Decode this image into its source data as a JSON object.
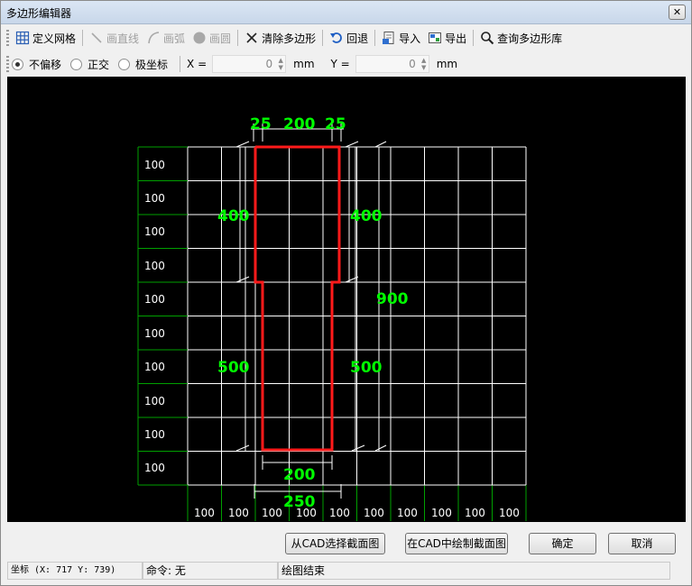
{
  "window": {
    "title": "多边形编辑器",
    "close": "✕"
  },
  "toolbar": {
    "define_grid": "定义网格",
    "draw_line": "画直线",
    "draw_arc": "画弧",
    "draw_circle": "画圆",
    "clear_polygon": "清除多边形",
    "undo": "回退",
    "import": "导入",
    "export": "导出",
    "query_library": "查询多边形库"
  },
  "options": {
    "no_offset": "不偏移",
    "orthogonal": "正交",
    "polar": "极坐标",
    "x_label": "X =",
    "x_value": "0",
    "y_label": "Y =",
    "y_value": "0",
    "unit": "mm"
  },
  "grid": {
    "row_labels": [
      "100",
      "100",
      "100",
      "100",
      "100",
      "100",
      "100",
      "100",
      "100",
      "100"
    ],
    "col_labels": [
      "100",
      "100",
      "100",
      "100",
      "100",
      "100",
      "100",
      "100",
      "100",
      "100"
    ]
  },
  "dimensions": {
    "top_left": "25",
    "top_mid": "200",
    "top_right": "25",
    "left_upper": "400",
    "right_upper": "400",
    "right_total": "900",
    "left_lower": "500",
    "right_lower": "500",
    "bottom_inner": "200",
    "bottom_outer": "250"
  },
  "colors": {
    "grid": "#ffffff",
    "axis": "#00a000",
    "polygon": "#ff0000",
    "dim_text": "#00ff00",
    "canvas": "#000000"
  },
  "buttons": {
    "select_from_cad": "从CAD选择截面图",
    "draw_in_cad": "在CAD中绘制截面图",
    "ok": "确定",
    "cancel": "取消"
  },
  "status": {
    "coords": "坐标 (X: 717 Y: 739)",
    "command": "命令: 无",
    "state": "绘图结束"
  }
}
